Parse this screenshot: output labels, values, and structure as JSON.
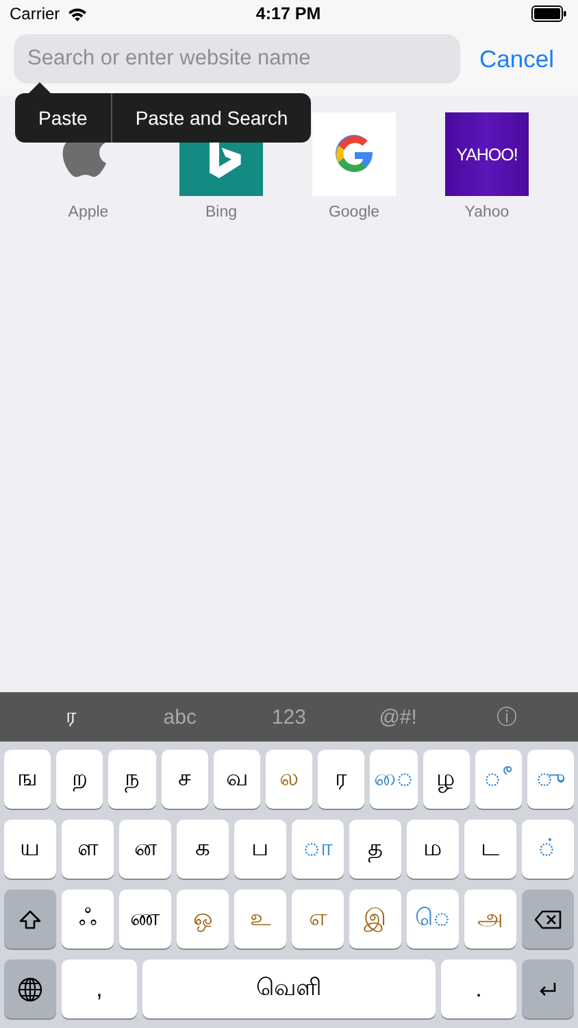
{
  "status_bar": {
    "carrier": "Carrier",
    "time": "4:17 PM"
  },
  "search": {
    "placeholder": "Search or enter website name",
    "cancel": "Cancel"
  },
  "edit_menu": [
    "Paste",
    "Paste and Search"
  ],
  "favorites": [
    {
      "label": "Apple",
      "kind": "apple"
    },
    {
      "label": "Bing",
      "kind": "bing"
    },
    {
      "label": "Google",
      "kind": "google"
    },
    {
      "label": "Yahoo",
      "kind": "yahoo",
      "logo_text": "YAHOO!"
    }
  ],
  "keyboard": {
    "tabs": [
      {
        "label": "ர",
        "selected": true
      },
      {
        "label": "abc",
        "selected": false
      },
      {
        "label": "123",
        "selected": false
      },
      {
        "label": "@#!",
        "selected": false
      },
      {
        "label": "ⓘ",
        "selected": false
      }
    ],
    "rows": [
      {
        "keys": [
          {
            "kind": "char",
            "label": "ங",
            "color": "#000000"
          },
          {
            "kind": "char",
            "label": "ற",
            "color": "#000000"
          },
          {
            "kind": "char",
            "label": "ந",
            "color": "#000000"
          },
          {
            "kind": "char",
            "label": "ச",
            "color": "#000000"
          },
          {
            "kind": "char",
            "label": "வ",
            "color": "#000000"
          },
          {
            "kind": "char",
            "label": "ல",
            "color": "#a0671b"
          },
          {
            "kind": "char",
            "label": "ர",
            "color": "#000000"
          },
          {
            "kind": "char",
            "label": "◌ை",
            "color": "#3a87c8"
          },
          {
            "kind": "char",
            "label": "ழ",
            "color": "#000000"
          },
          {
            "kind": "char",
            "label": "◌ீ",
            "color": "#3a87c8"
          },
          {
            "kind": "char",
            "label": "◌ு",
            "color": "#3a87c8"
          }
        ]
      },
      {
        "keys": [
          {
            "kind": "char",
            "label": "ய",
            "color": "#000000"
          },
          {
            "kind": "char",
            "label": "ள",
            "color": "#000000"
          },
          {
            "kind": "char",
            "label": "ன",
            "color": "#000000"
          },
          {
            "kind": "char",
            "label": "க",
            "color": "#000000"
          },
          {
            "kind": "char",
            "label": "ப",
            "color": "#000000"
          },
          {
            "kind": "char",
            "label": "◌ா",
            "color": "#3a87c8"
          },
          {
            "kind": "char",
            "label": "த",
            "color": "#000000"
          },
          {
            "kind": "char",
            "label": "ம",
            "color": "#000000"
          },
          {
            "kind": "char",
            "label": "ட",
            "color": "#000000"
          },
          {
            "kind": "char",
            "label": "◌்",
            "color": "#3a87c8"
          }
        ]
      },
      {
        "keys": [
          {
            "kind": "shift"
          },
          {
            "kind": "char",
            "label": "ஃ",
            "color": "#000000"
          },
          {
            "kind": "char",
            "label": "ண",
            "color": "#000000"
          },
          {
            "kind": "char",
            "label": "ஒ",
            "color": "#a0671b"
          },
          {
            "kind": "char",
            "label": "உ",
            "color": "#a0671b"
          },
          {
            "kind": "char",
            "label": "எ",
            "color": "#a0671b"
          },
          {
            "kind": "char",
            "label": "இ",
            "color": "#a0671b"
          },
          {
            "kind": "char",
            "label": "◌ெ",
            "color": "#3a87c8"
          },
          {
            "kind": "char",
            "label": "அ",
            "color": "#a0671b"
          },
          {
            "kind": "delete"
          }
        ]
      },
      {
        "keys": [
          {
            "kind": "globe"
          },
          {
            "kind": "char",
            "label": ",",
            "color": "#000000"
          },
          {
            "kind": "space",
            "label": "வெளி"
          },
          {
            "kind": "char",
            "label": ".",
            "color": "#000000"
          },
          {
            "kind": "return"
          }
        ]
      }
    ]
  }
}
